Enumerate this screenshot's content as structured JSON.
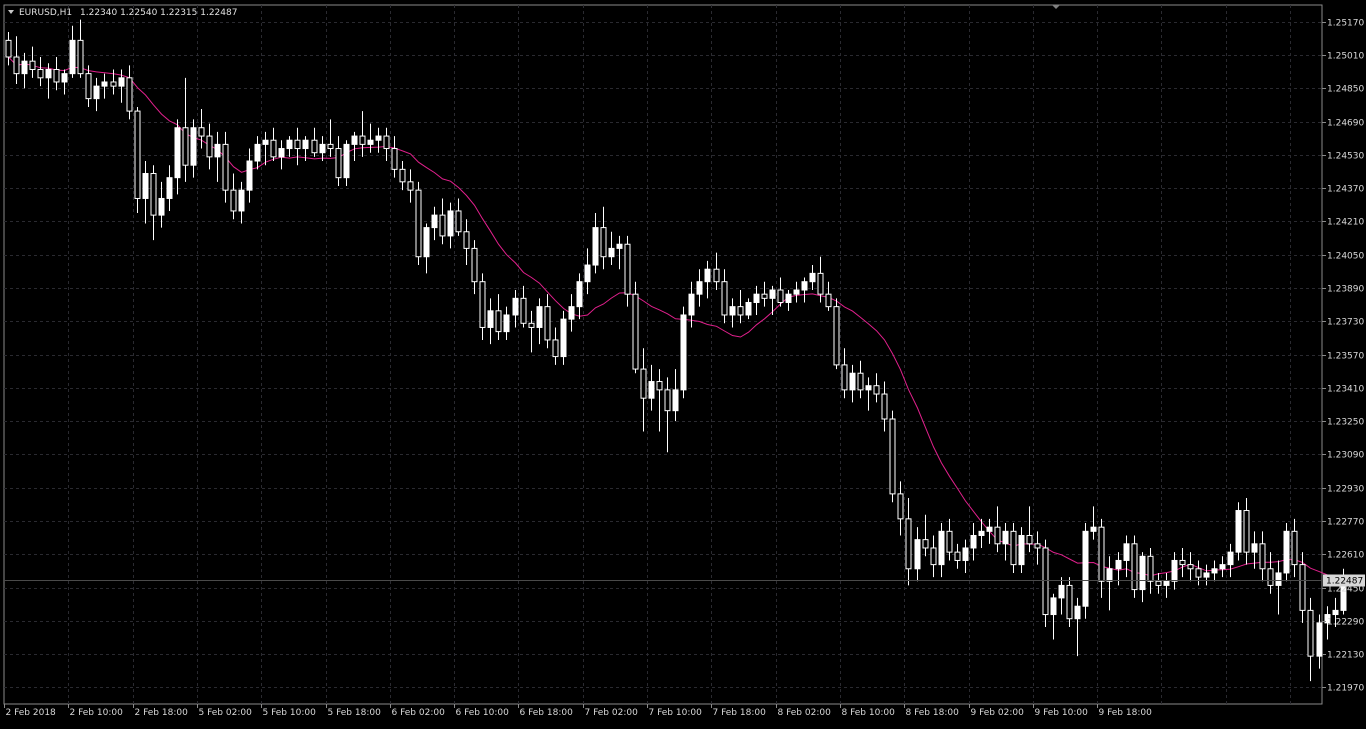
{
  "header": {
    "symbol": "EURUSD,H1",
    "ohlc": "1.22340 1.22540 1.22315 1.22487"
  },
  "chart_data": {
    "type": "candlestick",
    "symbol": "EURUSD",
    "timeframe": "H1",
    "ylim": [
      1.2189,
      1.2525
    ],
    "y_ticks": [
      "1.25170",
      "1.25010",
      "1.24850",
      "1.24690",
      "1.24530",
      "1.24370",
      "1.24210",
      "1.24050",
      "1.23890",
      "1.23730",
      "1.23570",
      "1.23410",
      "1.23250",
      "1.23090",
      "1.22930",
      "1.22770",
      "1.22610",
      "1.22450",
      "1.22290",
      "1.22130",
      "1.21970"
    ],
    "x_ticks": [
      "2 Feb 2018",
      "2 Feb 10:00",
      "2 Feb 18:00",
      "5 Feb 02:00",
      "5 Feb 10:00",
      "5 Feb 18:00",
      "6 Feb 02:00",
      "6 Feb 10:00",
      "6 Feb 18:00",
      "7 Feb 02:00",
      "7 Feb 10:00",
      "7 Feb 18:00",
      "8 Feb 02:00",
      "8 Feb 10:00",
      "8 Feb 18:00",
      "9 Feb 02:00",
      "9 Feb 10:00",
      "9 Feb 18:00"
    ],
    "current_price": "1.22487",
    "grid": true,
    "ma_color": "#e0208c",
    "bull_color": "#ffffff",
    "bear_color": "#000000",
    "candles": [
      [
        1.2508,
        1.2512,
        1.2496,
        1.25
      ],
      [
        1.25,
        1.251,
        1.2487,
        1.2492
      ],
      [
        1.2492,
        1.2502,
        1.2485,
        1.2498
      ],
      [
        1.2498,
        1.2505,
        1.249,
        1.2494
      ],
      [
        1.2494,
        1.25,
        1.2486,
        1.249
      ],
      [
        1.249,
        1.2497,
        1.248,
        1.2494
      ],
      [
        1.2494,
        1.25,
        1.2484,
        1.2488
      ],
      [
        1.2488,
        1.2494,
        1.2482,
        1.2492
      ],
      [
        1.2492,
        1.2515,
        1.249,
        1.2508
      ],
      [
        1.2508,
        1.2518,
        1.249,
        1.2492
      ],
      [
        1.2492,
        1.2496,
        1.2476,
        1.248
      ],
      [
        1.248,
        1.249,
        1.2474,
        1.2486
      ],
      [
        1.2486,
        1.2492,
        1.248,
        1.2488
      ],
      [
        1.2488,
        1.2494,
        1.2482,
        1.2486
      ],
      [
        1.2486,
        1.2494,
        1.2478,
        1.249
      ],
      [
        1.249,
        1.2496,
        1.247,
        1.2474
      ],
      [
        1.2474,
        1.2476,
        1.2425,
        1.2432
      ],
      [
        1.2432,
        1.245,
        1.242,
        1.2444
      ],
      [
        1.2444,
        1.2448,
        1.2412,
        1.2424
      ],
      [
        1.2424,
        1.244,
        1.2418,
        1.2432
      ],
      [
        1.2432,
        1.2448,
        1.2426,
        1.2442
      ],
      [
        1.2442,
        1.247,
        1.2434,
        1.2466
      ],
      [
        1.2466,
        1.249,
        1.244,
        1.2448
      ],
      [
        1.2448,
        1.247,
        1.2442,
        1.2466
      ],
      [
        1.2466,
        1.2475,
        1.2456,
        1.2462
      ],
      [
        1.2462,
        1.2468,
        1.2446,
        1.2452
      ],
      [
        1.2452,
        1.2464,
        1.244,
        1.2458
      ],
      [
        1.2458,
        1.2464,
        1.243,
        1.2436
      ],
      [
        1.2436,
        1.2444,
        1.2422,
        1.2426
      ],
      [
        1.2426,
        1.244,
        1.242,
        1.2436
      ],
      [
        1.2436,
        1.2456,
        1.243,
        1.245
      ],
      [
        1.245,
        1.2462,
        1.2446,
        1.2458
      ],
      [
        1.2458,
        1.2464,
        1.2448,
        1.246
      ],
      [
        1.246,
        1.2466,
        1.245,
        1.2452
      ],
      [
        1.2452,
        1.246,
        1.2446,
        1.2456
      ],
      [
        1.2456,
        1.2462,
        1.2452,
        1.246
      ],
      [
        1.246,
        1.2466,
        1.2448,
        1.2456
      ],
      [
        1.2456,
        1.2462,
        1.245,
        1.246
      ],
      [
        1.246,
        1.2466,
        1.2452,
        1.2454
      ],
      [
        1.2454,
        1.2462,
        1.245,
        1.2458
      ],
      [
        1.2458,
        1.247,
        1.2452,
        1.2456
      ],
      [
        1.2456,
        1.2462,
        1.2438,
        1.2442
      ],
      [
        1.2442,
        1.246,
        1.2438,
        1.2458
      ],
      [
        1.2458,
        1.2464,
        1.245,
        1.2462
      ],
      [
        1.2462,
        1.2474,
        1.2452,
        1.2458
      ],
      [
        1.2458,
        1.2468,
        1.2454,
        1.246
      ],
      [
        1.246,
        1.2466,
        1.2454,
        1.2462
      ],
      [
        1.2462,
        1.2466,
        1.245,
        1.2456
      ],
      [
        1.2456,
        1.2462,
        1.2442,
        1.2446
      ],
      [
        1.2446,
        1.245,
        1.2436,
        1.244
      ],
      [
        1.244,
        1.2446,
        1.243,
        1.2436
      ],
      [
        1.2436,
        1.244,
        1.24,
        1.2404
      ],
      [
        1.2404,
        1.242,
        1.2396,
        1.2418
      ],
      [
        1.2418,
        1.2428,
        1.2412,
        1.2424
      ],
      [
        1.2424,
        1.2432,
        1.241,
        1.2414
      ],
      [
        1.2414,
        1.243,
        1.2408,
        1.2426
      ],
      [
        1.2426,
        1.2432,
        1.2414,
        1.2416
      ],
      [
        1.2416,
        1.2422,
        1.24,
        1.2408
      ],
      [
        1.2408,
        1.2412,
        1.2386,
        1.2392
      ],
      [
        1.2392,
        1.2396,
        1.2364,
        1.237
      ],
      [
        1.237,
        1.2384,
        1.2362,
        1.2378
      ],
      [
        1.2378,
        1.2386,
        1.2364,
        1.2368
      ],
      [
        1.2368,
        1.238,
        1.2364,
        1.2376
      ],
      [
        1.2376,
        1.2388,
        1.237,
        1.2384
      ],
      [
        1.2384,
        1.239,
        1.237,
        1.2372
      ],
      [
        1.2372,
        1.2378,
        1.2358,
        1.237
      ],
      [
        1.237,
        1.2384,
        1.2362,
        1.238
      ],
      [
        1.238,
        1.2386,
        1.236,
        1.2364
      ],
      [
        1.2364,
        1.237,
        1.2352,
        1.2356
      ],
      [
        1.2356,
        1.2378,
        1.2352,
        1.2374
      ],
      [
        1.2374,
        1.2386,
        1.2368,
        1.238
      ],
      [
        1.238,
        1.2396,
        1.2374,
        1.2392
      ],
      [
        1.2392,
        1.2408,
        1.2386,
        1.24
      ],
      [
        1.24,
        1.2425,
        1.2396,
        1.2418
      ],
      [
        1.2418,
        1.2428,
        1.2398,
        1.2404
      ],
      [
        1.2404,
        1.2416,
        1.24,
        1.2408
      ],
      [
        1.2408,
        1.2414,
        1.2398,
        1.241
      ],
      [
        1.241,
        1.2414,
        1.238,
        1.2386
      ],
      [
        1.2386,
        1.2392,
        1.2348,
        1.235
      ],
      [
        1.235,
        1.236,
        1.232,
        1.2336
      ],
      [
        1.2336,
        1.2352,
        1.233,
        1.2344
      ],
      [
        1.2344,
        1.235,
        1.232,
        1.234
      ],
      [
        1.234,
        1.2346,
        1.231,
        1.233
      ],
      [
        1.233,
        1.235,
        1.2325,
        1.234
      ],
      [
        1.234,
        1.238,
        1.2336,
        1.2376
      ],
      [
        1.2376,
        1.2392,
        1.237,
        1.2386
      ],
      [
        1.2386,
        1.2398,
        1.238,
        1.2392
      ],
      [
        1.2392,
        1.2402,
        1.2384,
        1.2398
      ],
      [
        1.2398,
        1.2406,
        1.2388,
        1.2392
      ],
      [
        1.2392,
        1.2398,
        1.2372,
        1.2376
      ],
      [
        1.2376,
        1.2384,
        1.237,
        1.238
      ],
      [
        1.238,
        1.2388,
        1.2372,
        1.2376
      ],
      [
        1.2376,
        1.2384,
        1.2374,
        1.2382
      ],
      [
        1.2382,
        1.239,
        1.2376,
        1.2386
      ],
      [
        1.2386,
        1.2392,
        1.238,
        1.2384
      ],
      [
        1.2384,
        1.239,
        1.2376,
        1.2388
      ],
      [
        1.2388,
        1.2394,
        1.238,
        1.2382
      ],
      [
        1.2382,
        1.2388,
        1.2378,
        1.2386
      ],
      [
        1.2386,
        1.2392,
        1.2382,
        1.2388
      ],
      [
        1.2388,
        1.2394,
        1.2382,
        1.2392
      ],
      [
        1.2392,
        1.24,
        1.2388,
        1.2396
      ],
      [
        1.2396,
        1.2404,
        1.2382,
        1.2386
      ],
      [
        1.2386,
        1.2392,
        1.2378,
        1.238
      ],
      [
        1.238,
        1.2384,
        1.235,
        1.2352
      ],
      [
        1.2352,
        1.236,
        1.2336,
        1.234
      ],
      [
        1.234,
        1.2352,
        1.2334,
        1.2348
      ],
      [
        1.2348,
        1.2354,
        1.2336,
        1.234
      ],
      [
        1.234,
        1.2346,
        1.233,
        1.2342
      ],
      [
        1.2342,
        1.2348,
        1.2334,
        1.2338
      ],
      [
        1.2338,
        1.2344,
        1.232,
        1.2326
      ],
      [
        1.2326,
        1.233,
        1.2286,
        1.229
      ],
      [
        1.229,
        1.2296,
        1.227,
        1.2278
      ],
      [
        1.2278,
        1.2288,
        1.2246,
        1.2254
      ],
      [
        1.2254,
        1.2274,
        1.2248,
        1.2268
      ],
      [
        1.2268,
        1.228,
        1.226,
        1.2264
      ],
      [
        1.2264,
        1.227,
        1.225,
        1.2256
      ],
      [
        1.2256,
        1.2276,
        1.225,
        1.2272
      ],
      [
        1.2272,
        1.2278,
        1.2258,
        1.2262
      ],
      [
        1.2262,
        1.2266,
        1.2254,
        1.2258
      ],
      [
        1.2258,
        1.2268,
        1.2252,
        1.2264
      ],
      [
        1.2264,
        1.2276,
        1.2258,
        1.227
      ],
      [
        1.227,
        1.2278,
        1.2264,
        1.2272
      ],
      [
        1.2272,
        1.2278,
        1.2266,
        1.2274
      ],
      [
        1.2274,
        1.2284,
        1.2262,
        1.2266
      ],
      [
        1.2266,
        1.2276,
        1.2258,
        1.2272
      ],
      [
        1.2272,
        1.2276,
        1.2252,
        1.2256
      ],
      [
        1.2256,
        1.2274,
        1.2252,
        1.227
      ],
      [
        1.227,
        1.2284,
        1.2262,
        1.2266
      ],
      [
        1.2266,
        1.2272,
        1.2256,
        1.2264
      ],
      [
        1.2264,
        1.2268,
        1.2226,
        1.2232
      ],
      [
        1.2232,
        1.2242,
        1.222,
        1.224
      ],
      [
        1.224,
        1.225,
        1.2232,
        1.2246
      ],
      [
        1.2246,
        1.225,
        1.2226,
        1.223
      ],
      [
        1.223,
        1.224,
        1.2212,
        1.2236
      ],
      [
        1.2236,
        1.2276,
        1.223,
        1.2272
      ],
      [
        1.2272,
        1.2284,
        1.2268,
        1.2274
      ],
      [
        1.2274,
        1.2278,
        1.224,
        1.2248
      ],
      [
        1.2248,
        1.226,
        1.2234,
        1.2254
      ],
      [
        1.2254,
        1.2262,
        1.2246,
        1.2258
      ],
      [
        1.2258,
        1.227,
        1.225,
        1.2266
      ],
      [
        1.2266,
        1.227,
        1.224,
        1.2244
      ],
      [
        1.2244,
        1.2262,
        1.2238,
        1.226
      ],
      [
        1.226,
        1.2264,
        1.2242,
        1.2248
      ],
      [
        1.2248,
        1.2252,
        1.2242,
        1.2246
      ],
      [
        1.2246,
        1.2252,
        1.224,
        1.2248
      ],
      [
        1.2248,
        1.2262,
        1.2244,
        1.2258
      ],
      [
        1.2258,
        1.2264,
        1.225,
        1.2256
      ],
      [
        1.2256,
        1.2262,
        1.2248,
        1.2254
      ],
      [
        1.2254,
        1.2258,
        1.2246,
        1.225
      ],
      [
        1.225,
        1.2256,
        1.2246,
        1.2252
      ],
      [
        1.2252,
        1.2258,
        1.2248,
        1.2254
      ],
      [
        1.2254,
        1.226,
        1.225,
        1.2256
      ],
      [
        1.2256,
        1.2266,
        1.225,
        1.2262
      ],
      [
        1.2262,
        1.2286,
        1.2258,
        1.2282
      ],
      [
        1.2282,
        1.2288,
        1.2256,
        1.2262
      ],
      [
        1.2262,
        1.2272,
        1.2254,
        1.2266
      ],
      [
        1.2266,
        1.2272,
        1.2248,
        1.2254
      ],
      [
        1.2254,
        1.2262,
        1.2242,
        1.2246
      ],
      [
        1.2246,
        1.2258,
        1.2232,
        1.2252
      ],
      [
        1.2252,
        1.2276,
        1.2248,
        1.2272
      ],
      [
        1.2272,
        1.2278,
        1.225,
        1.2256
      ],
      [
        1.2256,
        1.2262,
        1.2228,
        1.2234
      ],
      [
        1.2234,
        1.224,
        1.22,
        1.2212
      ],
      [
        1.2212,
        1.2232,
        1.2206,
        1.2228
      ],
      [
        1.2228,
        1.2236,
        1.222,
        1.2232
      ],
      [
        1.2232,
        1.224,
        1.2226,
        1.2234
      ],
      [
        1.2234,
        1.2254,
        1.2232,
        1.2249
      ]
    ]
  }
}
